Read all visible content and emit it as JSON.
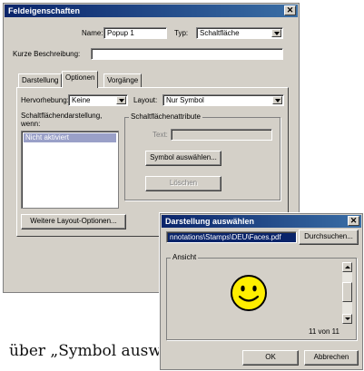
{
  "field_dialog": {
    "title": "Feldeigenschaften",
    "name_label": "Name:",
    "name_value": "Popup 1",
    "type_label": "Typ:",
    "type_value": "Schaltfläche",
    "desc_label": "Kurze Beschreibung:",
    "desc_value": "",
    "tabs": [
      "Darstellung",
      "Optionen",
      "Vorgänge"
    ],
    "active_tab": "Optionen",
    "highlight_label": "Hervorhebung:",
    "highlight_value": "Keine",
    "layout_label": "Layout:",
    "layout_value": "Nur Symbol",
    "appearance_label_1": "Schaltflächendarstellung,",
    "appearance_label_2": "wenn:",
    "appearance_list": [
      "Nicht aktiviert"
    ],
    "attributes_group": "Schaltflächenattribute",
    "text_label": "Text:",
    "text_value": "",
    "choose_icon_button": "Symbol auswählen...",
    "delete_button": "Löschen",
    "more_layout_button": "Weitere Layout-Optionen..."
  },
  "select_dialog": {
    "title": "Darstellung auswählen",
    "path_value": "nnotations\\Stamps\\DEU\\Faces.pdf",
    "browse_button": "Durchsuchen...",
    "preview_group": "Ansicht",
    "preview_icon": "smiley-face",
    "page_counter": "11 von 11",
    "ok_button": "OK",
    "cancel_button": "Abbrechen"
  },
  "caption_text": "über „Symbol auswählen“",
  "colors": {
    "titlebar_start": "#0a246a",
    "titlebar_end": "#3a6ea5",
    "dialog_bg": "#d4d0c8",
    "smiley_fill": "#ffee00"
  }
}
